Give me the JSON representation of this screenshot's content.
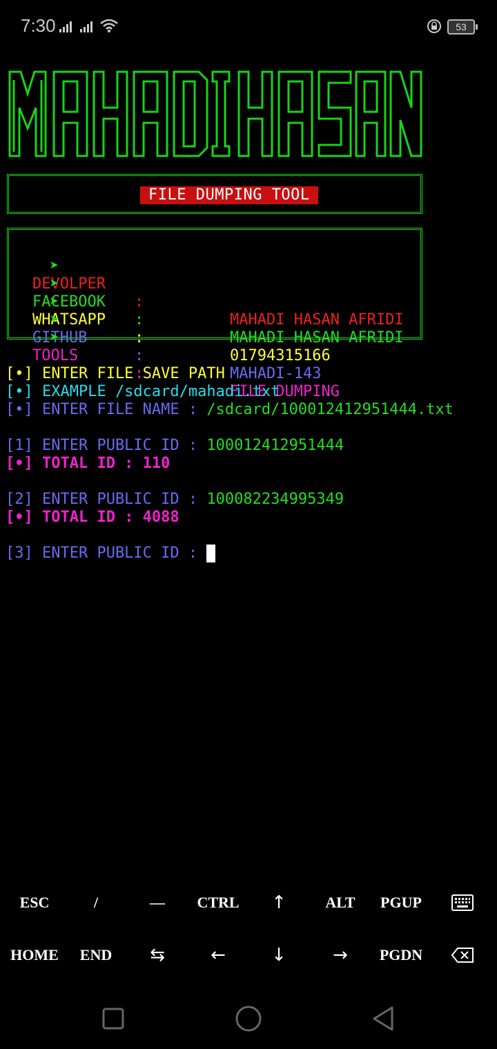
{
  "status_bar": {
    "time": "7:30",
    "battery": "53"
  },
  "banner": {
    "text": "MAHADI HASAN",
    "color": "#19d219"
  },
  "tool_title": "FILE DUMPING TOOL",
  "info": [
    {
      "label": "DEVOLPER",
      "value": "MAHADI HASAN AFRIDI",
      "color": "#ee2020"
    },
    {
      "label": "FACEBOOK",
      "value": "MAHADI HASAN AFRIDI",
      "color": "#22dd22"
    },
    {
      "label": "WHATSAPP",
      "value": "01794315166",
      "color": "#ffff33"
    },
    {
      "label": "GITHUB",
      "value": "MAHADI-143",
      "color": "#6a6af0"
    },
    {
      "label": "TOOLS",
      "value": "FILE DUMPING",
      "color": "#ee22cc"
    }
  ],
  "terminal": {
    "save_path_prompt": "[•] ENTER FILE SAVE PATH",
    "example_prompt": "[•] EXAMPLE /sdcard/mahadi.txt",
    "file_name_prompt": "[•] ENTER FILE NAME : ",
    "file_name_value": "/sdcard/100012412951444.txt",
    "entries": [
      {
        "prompt": "[1] ENTER PUBLIC ID : ",
        "id": "100012412951444",
        "total": "[•] TOTAL ID : 110"
      },
      {
        "prompt": "[2] ENTER PUBLIC ID : ",
        "id": "100082234995349",
        "total": "[•] TOTAL ID : 4088"
      }
    ],
    "current_prompt": "[3] ENTER PUBLIC ID : "
  },
  "extra_keys": {
    "row1": [
      "ESC",
      "/",
      "—",
      "CTRL",
      "↑",
      "ALT",
      "PGUP",
      "keyboard-icon"
    ],
    "row2": [
      "HOME",
      "END",
      "⇆",
      "←",
      "↓",
      "→",
      "PGDN",
      "backspace-icon"
    ]
  }
}
